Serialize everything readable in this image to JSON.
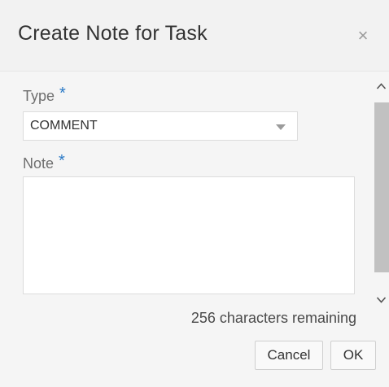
{
  "dialog": {
    "title": "Create Note for Task",
    "close_symbol": "×"
  },
  "form": {
    "type_label": "Type",
    "type_required_mark": "*",
    "type_value": "COMMENT",
    "note_label": "Note",
    "note_required_mark": "*",
    "note_value": "",
    "characters_remaining": "256 characters remaining"
  },
  "buttons": {
    "cancel_label": "Cancel",
    "ok_label": "OK"
  },
  "icons": {
    "close": "close-icon",
    "dropdown": "chevron-down-icon",
    "scroll_up": "chevron-up-icon",
    "scroll_down": "chevron-down-icon"
  },
  "colors": {
    "required_asterisk": "#2a79c6",
    "header_background": "#f2f2f2",
    "body_background": "#f5f5f5"
  }
}
